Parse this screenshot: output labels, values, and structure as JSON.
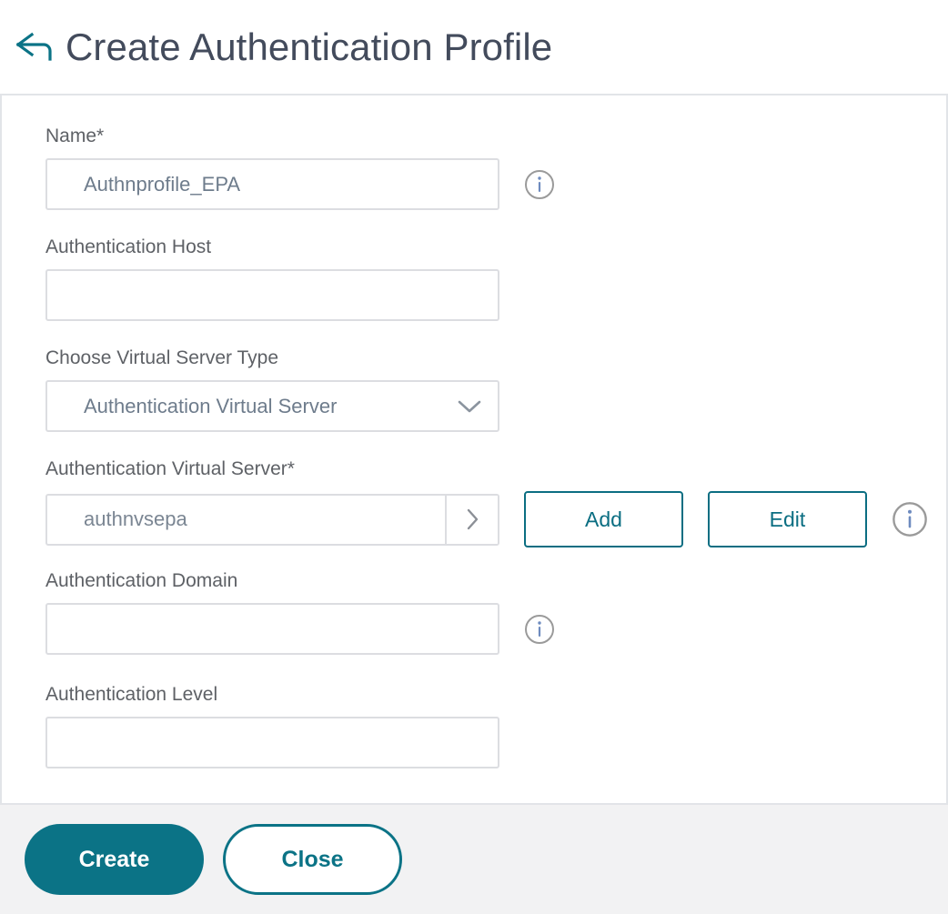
{
  "header": {
    "back_icon": "back-arrow-icon",
    "title": "Create Authentication Profile"
  },
  "form": {
    "name": {
      "label": "Name*",
      "value": "Authnprofile_EPA",
      "placeholder": "",
      "info_icon": "info-icon"
    },
    "auth_host": {
      "label": "Authentication Host",
      "value": "",
      "placeholder": ""
    },
    "vserver_type": {
      "label": "Choose Virtual Server Type",
      "value": "Authentication Virtual Server",
      "chevron_icon": "chevron-down-icon",
      "options": [
        "Authentication Virtual Server"
      ]
    },
    "auth_vserver": {
      "label": "Authentication Virtual Server*",
      "value": "authnvsepa",
      "arrow_icon": "chevron-right-icon",
      "add_label": "Add",
      "edit_label": "Edit",
      "info_icon": "info-icon"
    },
    "auth_domain": {
      "label": "Authentication Domain",
      "value": "",
      "placeholder": "",
      "info_icon": "info-icon"
    },
    "auth_level": {
      "label": "Authentication Level",
      "value": "",
      "placeholder": ""
    }
  },
  "footer": {
    "create_label": "Create",
    "close_label": "Close"
  },
  "colors": {
    "accent_teal": "#0b7386",
    "title_slate": "#434b5c",
    "label_gray": "#5e6166",
    "value_gray": "#6e7c8c",
    "border_gray": "#dcdde1",
    "footer_bg": "#f2f2f3",
    "panel_border": "#e2e4e8",
    "info_circle": "#9a9a9a",
    "info_glyph": "#6e8bbf"
  }
}
